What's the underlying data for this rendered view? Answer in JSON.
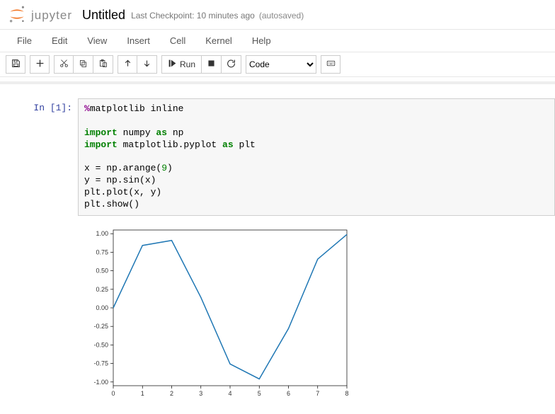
{
  "header": {
    "logo_text": "jupyter",
    "title": "Untitled",
    "checkpoint": "Last Checkpoint: 10 minutes ago",
    "autosaved": "(autosaved)"
  },
  "menu": [
    "File",
    "Edit",
    "View",
    "Insert",
    "Cell",
    "Kernel",
    "Help"
  ],
  "toolbar": {
    "run_label": "Run",
    "celltype": "Code"
  },
  "cell": {
    "prompt": "In [1]:",
    "code_tokens": [
      {
        "t": "%",
        "c": "c-magic"
      },
      {
        "t": "matplotlib inline",
        "c": "c-mod"
      },
      {
        "t": "\n\n",
        "c": ""
      },
      {
        "t": "import",
        "c": "c-key"
      },
      {
        "t": " numpy ",
        "c": "c-mod"
      },
      {
        "t": "as",
        "c": "c-key"
      },
      {
        "t": " np\n",
        "c": "c-mod"
      },
      {
        "t": "import",
        "c": "c-key"
      },
      {
        "t": " matplotlib.pyplot ",
        "c": "c-mod"
      },
      {
        "t": "as",
        "c": "c-key"
      },
      {
        "t": " plt\n\n",
        "c": "c-mod"
      },
      {
        "t": "x = np.arange(",
        "c": "c-mod"
      },
      {
        "t": "9",
        "c": "c-num"
      },
      {
        "t": ")\n",
        "c": "c-mod"
      },
      {
        "t": "y = np.sin(x)\n",
        "c": "c-mod"
      },
      {
        "t": "plt.plot(x, y)\n",
        "c": "c-mod"
      },
      {
        "t": "plt.show()",
        "c": "c-mod"
      }
    ]
  },
  "chart_data": {
    "type": "line",
    "x": [
      0,
      1,
      2,
      3,
      4,
      5,
      6,
      7,
      8
    ],
    "y": [
      0.0,
      0.8415,
      0.9093,
      0.1411,
      -0.7568,
      -0.9589,
      -0.2794,
      0.657,
      0.9894
    ],
    "yticks": [
      -1.0,
      -0.75,
      -0.5,
      -0.25,
      0.0,
      0.25,
      0.5,
      0.75,
      1.0
    ],
    "xticks": [
      0,
      1,
      2,
      3,
      4,
      5,
      6,
      7,
      8
    ],
    "title": "",
    "xlabel": "",
    "ylabel": "",
    "xlim": [
      0,
      8
    ],
    "ylim": [
      -1.05,
      1.05
    ]
  }
}
